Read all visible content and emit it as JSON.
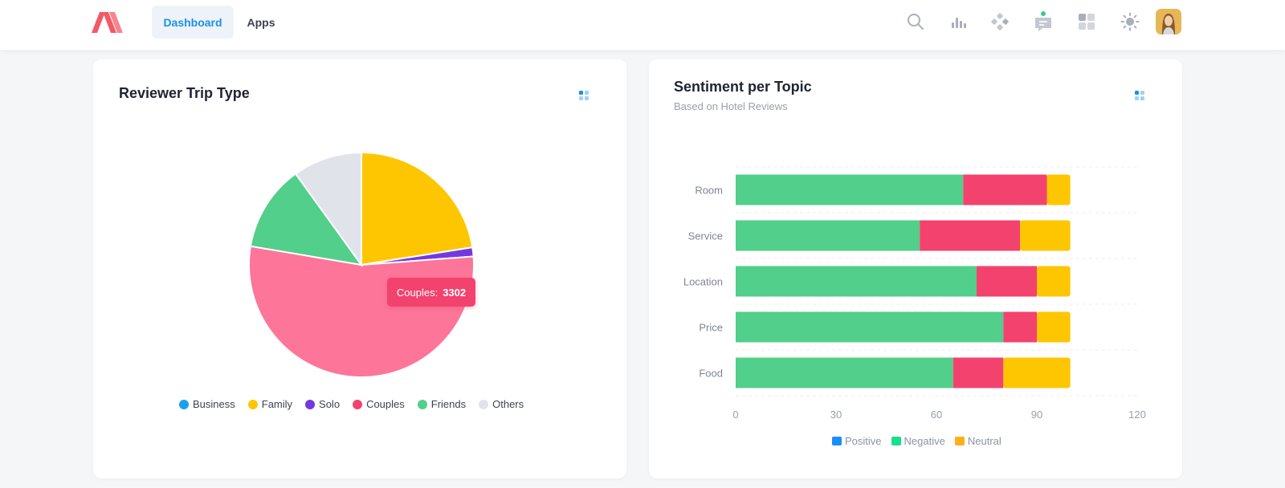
{
  "nav": {
    "tabs": [
      {
        "label": "Dashboard",
        "active": true
      },
      {
        "label": "Apps",
        "active": false
      }
    ]
  },
  "topbar": {
    "icons": [
      "search-icon",
      "chart-icon",
      "apps-diamond-icon",
      "chat-icon",
      "grid-icon",
      "sun-icon"
    ],
    "notification_dot_color": "#3ac98b"
  },
  "colors": {
    "accent": "#1a91e6",
    "positive": "#1a8ffa",
    "negative": "#52cf8b",
    "neutral": "#fec600",
    "couples": "#f2426e",
    "family": "#fec600",
    "solo": "#7438e1",
    "business": "#1aa0f0",
    "friends": "#52cf8b",
    "others": "#e0e4ea"
  },
  "trip_card": {
    "title": "Reviewer Trip Type",
    "tooltip": {
      "label": "Couples:",
      "value": "3302"
    }
  },
  "sentiment_card": {
    "title": "Sentiment per Topic",
    "subtitle": "Based on Hotel Reviews"
  },
  "chart_data": [
    {
      "type": "pie",
      "title": "Reviewer Trip Type",
      "labels": [
        "Business",
        "Family",
        "Solo",
        "Couples",
        "Friends",
        "Others"
      ],
      "values": [
        0,
        1380,
        80,
        3302,
        760,
        610
      ],
      "colors": [
        "#1aa0f0",
        "#fec600",
        "#7438e1",
        "#fd7599",
        "#52cf8b",
        "#e0e4ea"
      ],
      "highlight": "Couples",
      "legend": "bottom"
    },
    {
      "type": "bar",
      "orientation": "horizontal",
      "stacked": true,
      "title": "Sentiment per Topic",
      "subtitle": "Based on Hotel Reviews",
      "categories": [
        "Room",
        "Service",
        "Location",
        "Price",
        "Food"
      ],
      "series": [
        {
          "name": "Positive",
          "values": [
            68,
            55,
            72,
            80,
            65
          ],
          "color": "#52cf8b"
        },
        {
          "name": "Negative",
          "values": [
            25,
            30,
            18,
            10,
            15
          ],
          "color": "#f4426e"
        },
        {
          "name": "Neutral",
          "values": [
            7,
            15,
            10,
            10,
            20
          ],
          "color": "#fec600"
        }
      ],
      "legend_colors": [
        "#1a8ffa",
        "#16e08b",
        "#feb019"
      ],
      "xlim": [
        0,
        120
      ],
      "xticks": [
        "0",
        "30",
        "60",
        "90",
        "120"
      ],
      "grid": true,
      "legend": "bottom"
    }
  ]
}
